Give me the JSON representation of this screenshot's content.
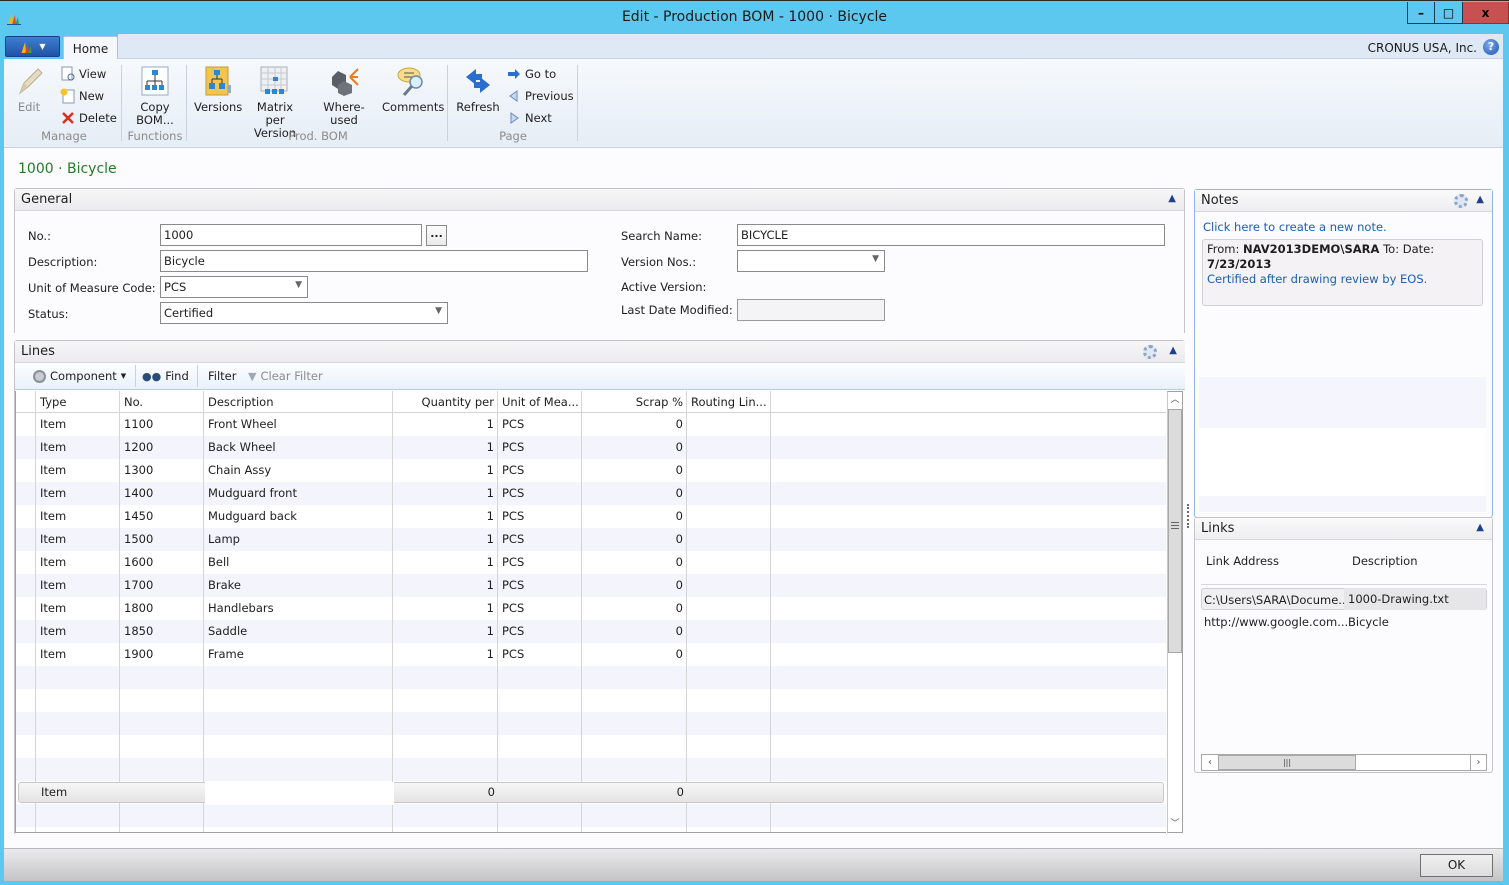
{
  "window": {
    "title": "Edit - Production BOM - 1000 · Bicycle",
    "buttons": {
      "minimize": "–",
      "maximize": "□",
      "close": "x"
    }
  },
  "tabs": {
    "home": "Home"
  },
  "company": "CRONUS USA, Inc.",
  "help": "?",
  "ribbon": {
    "groups": {
      "manage": {
        "label": "Manage",
        "edit": "Edit",
        "view": "View",
        "new": "New",
        "delete": "Delete"
      },
      "functions": {
        "label": "Functions",
        "copy_bom_line1": "Copy",
        "copy_bom_line2": "BOM..."
      },
      "prod_bom": {
        "label": "Prod. BOM",
        "versions": "Versions",
        "matrix_line1": "Matrix per",
        "matrix_line2": "Version",
        "where_used": "Where-used",
        "comments": "Comments"
      },
      "page": {
        "label": "Page",
        "refresh": "Refresh",
        "go_to": "Go to",
        "previous": "Previous",
        "next": "Next"
      }
    }
  },
  "page_title": "1000 · Bicycle",
  "general": {
    "title": "General",
    "fields": {
      "no": {
        "label": "No.:",
        "value": "1000"
      },
      "description": {
        "label": "Description:",
        "value": "Bicycle"
      },
      "uom": {
        "label": "Unit of Measure Code:",
        "value": "PCS"
      },
      "status": {
        "label": "Status:",
        "value": "Certified"
      },
      "search_name": {
        "label": "Search Name:",
        "value": "BICYCLE"
      },
      "version_nos": {
        "label": "Version Nos.:",
        "value": ""
      },
      "active_version": {
        "label": "Active Version:",
        "value": ""
      },
      "last_date_modified": {
        "label": "Last Date Modified:",
        "value": ""
      }
    },
    "assist_button": "..."
  },
  "lines": {
    "title": "Lines",
    "toolbar": {
      "component": "Component",
      "find": "Find",
      "filter": "Filter",
      "clear_filter": "Clear Filter"
    },
    "columns": [
      "Type",
      "No.",
      "Description",
      "Quantity per",
      "Unit of Mea...",
      "Scrap %",
      "Routing Lin..."
    ],
    "rows": [
      {
        "type": "Item",
        "no": "1100",
        "description": "Front Wheel",
        "qty": "1",
        "uom": "PCS",
        "scrap": "0",
        "routing": ""
      },
      {
        "type": "Item",
        "no": "1200",
        "description": "Back Wheel",
        "qty": "1",
        "uom": "PCS",
        "scrap": "0",
        "routing": ""
      },
      {
        "type": "Item",
        "no": "1300",
        "description": "Chain Assy",
        "qty": "1",
        "uom": "PCS",
        "scrap": "0",
        "routing": ""
      },
      {
        "type": "Item",
        "no": "1400",
        "description": "Mudguard front",
        "qty": "1",
        "uom": "PCS",
        "scrap": "0",
        "routing": ""
      },
      {
        "type": "Item",
        "no": "1450",
        "description": "Mudguard back",
        "qty": "1",
        "uom": "PCS",
        "scrap": "0",
        "routing": ""
      },
      {
        "type": "Item",
        "no": "1500",
        "description": "Lamp",
        "qty": "1",
        "uom": "PCS",
        "scrap": "0",
        "routing": ""
      },
      {
        "type": "Item",
        "no": "1600",
        "description": "Bell",
        "qty": "1",
        "uom": "PCS",
        "scrap": "0",
        "routing": ""
      },
      {
        "type": "Item",
        "no": "1700",
        "description": "Brake",
        "qty": "1",
        "uom": "PCS",
        "scrap": "0",
        "routing": ""
      },
      {
        "type": "Item",
        "no": "1800",
        "description": "Handlebars",
        "qty": "1",
        "uom": "PCS",
        "scrap": "0",
        "routing": ""
      },
      {
        "type": "Item",
        "no": "1850",
        "description": "Saddle",
        "qty": "1",
        "uom": "PCS",
        "scrap": "0",
        "routing": ""
      },
      {
        "type": "Item",
        "no": "1900",
        "description": "Frame",
        "qty": "1",
        "uom": "PCS",
        "scrap": "0",
        "routing": ""
      }
    ],
    "new_line": {
      "type": "Item",
      "qty": "0",
      "scrap": "0"
    }
  },
  "notes": {
    "title": "Notes",
    "create_link": "Click here to create a new note.",
    "items": [
      {
        "from_label": "From:",
        "from": "NAV2013DEMO\\SARA",
        "to_label": "To:",
        "date_label": "Date:",
        "date": "7/23/2013",
        "text": "Certified after drawing review by EOS."
      }
    ]
  },
  "links": {
    "title": "Links",
    "columns": [
      "Link Address",
      "Description"
    ],
    "rows": [
      {
        "address": "C:\\Users\\SARA\\Docume...",
        "description": "1000-Drawing.txt"
      },
      {
        "address": "http://www.google.com...",
        "description": "Bicycle"
      }
    ]
  },
  "footer": {
    "ok": "OK"
  }
}
